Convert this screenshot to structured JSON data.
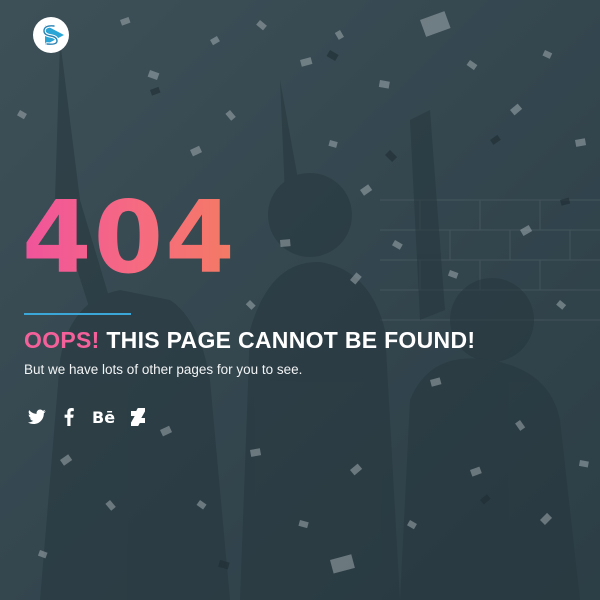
{
  "page": {
    "error_code": "404",
    "headline_accent": "OOPS!",
    "headline_rest": "THIS PAGE CANNOT BE FOUND!",
    "subtitle": "But we have lots of other pages for you to see."
  },
  "logo": {
    "icon": "brand-logo-icon"
  },
  "social": [
    {
      "name": "twitter",
      "icon": "twitter-icon"
    },
    {
      "name": "facebook",
      "icon": "facebook-icon"
    },
    {
      "name": "behance",
      "icon": "behance-icon",
      "label": "Bē"
    },
    {
      "name": "deviantart",
      "icon": "deviantart-icon"
    }
  ],
  "colors": {
    "accent_pink": "#f4619a",
    "gradient_start": "#f0539c",
    "gradient_end": "#f47b63",
    "divider_blue": "#3aa7d8",
    "overlay": "#3c4d55"
  }
}
